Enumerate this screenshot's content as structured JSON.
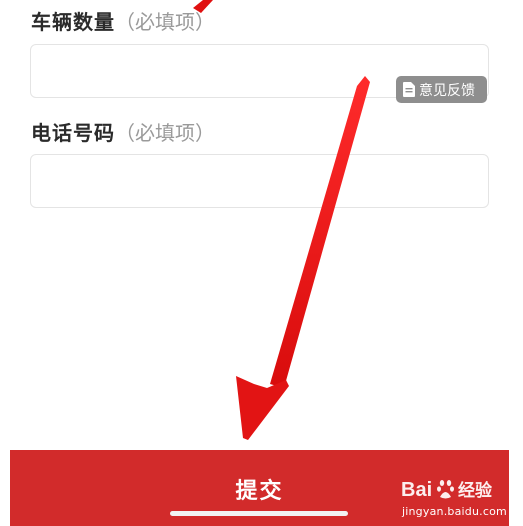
{
  "form": {
    "vehicle_count": {
      "label": "车辆数量",
      "hint": "（必填项）",
      "value": ""
    },
    "phone": {
      "label": "电话号码",
      "hint": "（必填项）",
      "value": ""
    }
  },
  "feedback_button": {
    "label": "意见反馈",
    "icon": "document-icon"
  },
  "submit": {
    "label": "提交"
  },
  "annotation": {
    "type": "red-arrow",
    "color": "#e01010"
  },
  "watermark": {
    "brand": "Bai经验",
    "url": "jingyan.baidu.com"
  },
  "colors": {
    "submit_background": "#d22b2b",
    "feedback_background": "#8e8e8e"
  }
}
